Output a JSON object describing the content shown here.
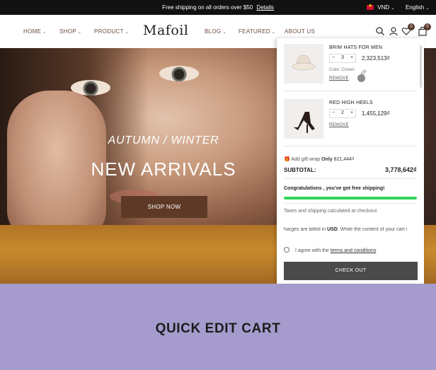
{
  "announcement": {
    "text": "Free shipping on all orders over $50",
    "link": "Details",
    "currency": "VND",
    "language": "English"
  },
  "header": {
    "nav_left": [
      {
        "label": "HOME"
      },
      {
        "label": "SHOP"
      },
      {
        "label": "PRODUCT"
      }
    ],
    "logo": "Mafoil",
    "nav_right": [
      {
        "label": "BLOG"
      },
      {
        "label": "FEATURED"
      },
      {
        "label": "ABOUT US"
      }
    ],
    "wishlist_count": "0",
    "cart_count": "0",
    "icons": [
      "search-icon",
      "user-icon",
      "heart-icon",
      "bag-icon"
    ]
  },
  "hero": {
    "kicker": "AUTUMN / WINTER",
    "title": "NEW ARRIVALS",
    "button": "SHOP NOW"
  },
  "cart": {
    "items": [
      {
        "name": "BRIM HATS FOR MEN",
        "quantity": "3",
        "price": "2,323,513₫",
        "color_label": "Color: Cream",
        "remove": "REMOVE"
      },
      {
        "name": "RED HIGH HEELS",
        "quantity": "2",
        "price": "1,455,129₫",
        "remove": "REMOVE"
      }
    ],
    "gift_wrap": {
      "label": "Add gift wrap",
      "only": "Only",
      "amount": "821,444₫"
    },
    "subtotal_label": "SUBTOTAL:",
    "subtotal_value": "3,778,642₫",
    "free_shipping_message": "Congratulations , you've got free shipping!",
    "free_shipping_progress": 1.0,
    "taxes_note": "Taxes and shipping calculated at checkout",
    "charges_note": {
      "prefix": "harges are billed in",
      "currency": "USD",
      "suffix": ". While the content of your cart i"
    },
    "agree": {
      "prefix": "I agree with the",
      "link": "terms and conditions"
    },
    "checkout": "CHECK OUT"
  },
  "caption": "QUICK EDIT CART",
  "colors": {
    "accent_brown": "#5e3a26",
    "progress_green": "#2fd65a",
    "caption_bg": "#a59bcc"
  }
}
